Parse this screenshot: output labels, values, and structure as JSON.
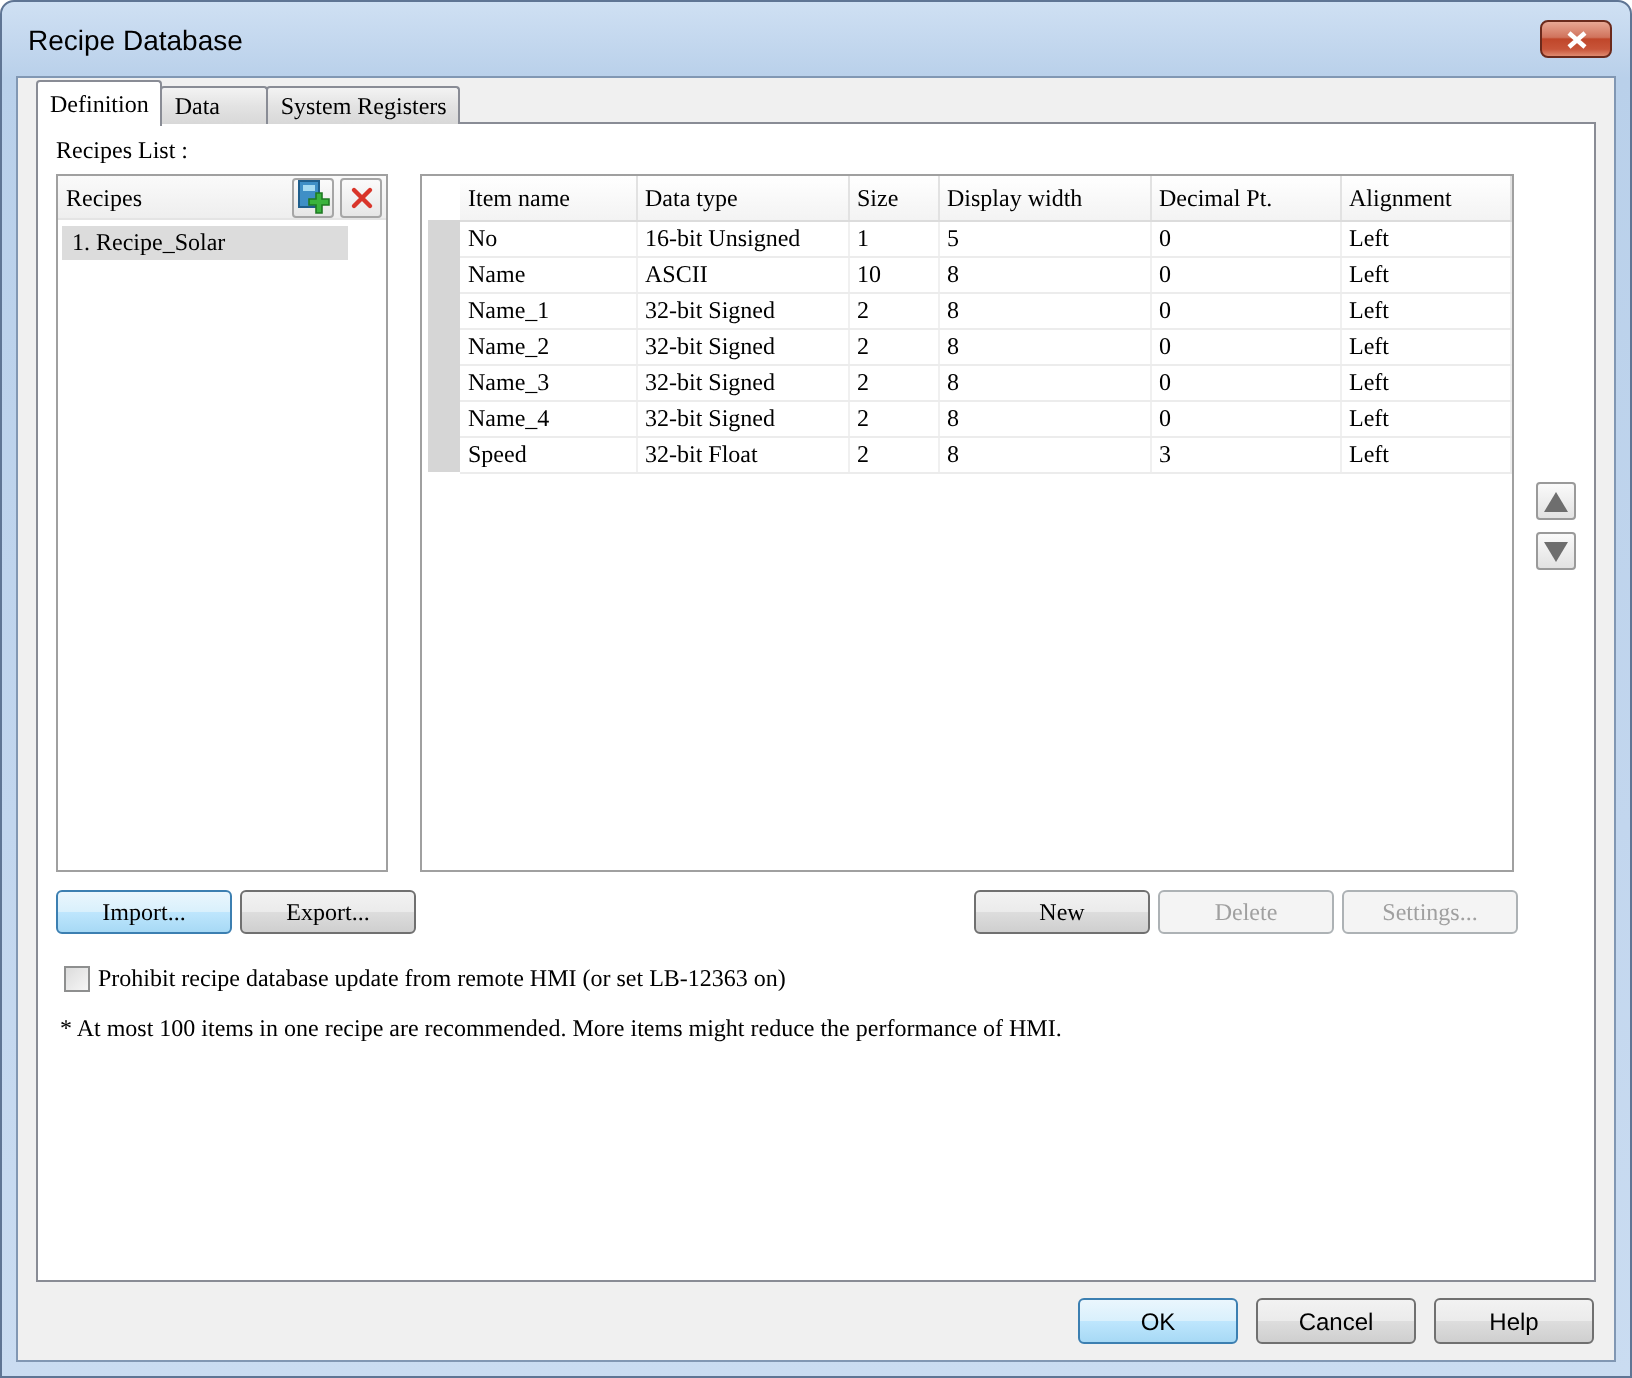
{
  "window": {
    "title": "Recipe Database"
  },
  "tabs": [
    {
      "label": "Definition",
      "selected": true
    },
    {
      "label": "Data",
      "selected": false
    },
    {
      "label": "System Registers",
      "selected": false
    }
  ],
  "recipes_list": {
    "label": "Recipes List :",
    "header": "Recipes",
    "items": [
      {
        "label": "1. Recipe_Solar",
        "selected": true
      }
    ]
  },
  "table": {
    "columns": [
      "Item name",
      "Data type",
      "Size",
      "Display width",
      "Decimal Pt.",
      "Alignment"
    ],
    "rows": [
      [
        "No",
        "16-bit Unsigned",
        "1",
        "5",
        "0",
        "Left"
      ],
      [
        "Name",
        "ASCII",
        "10",
        "8",
        "0",
        "Left"
      ],
      [
        "Name_1",
        "32-bit Signed",
        "2",
        "8",
        "0",
        "Left"
      ],
      [
        "Name_2",
        "32-bit Signed",
        "2",
        "8",
        "0",
        "Left"
      ],
      [
        "Name_3",
        "32-bit Signed",
        "2",
        "8",
        "0",
        "Left"
      ],
      [
        "Name_4",
        "32-bit Signed",
        "2",
        "8",
        "0",
        "Left"
      ],
      [
        "Speed",
        "32-bit Float",
        "2",
        "8",
        "3",
        "Left"
      ]
    ]
  },
  "recipe_buttons": [
    {
      "label": "Import...",
      "focused": true
    },
    {
      "label": "Export...",
      "focused": false
    }
  ],
  "item_buttons": [
    {
      "label": "New",
      "disabled": false
    },
    {
      "label": "Delete",
      "disabled": true
    },
    {
      "label": "Settings...",
      "disabled": true
    }
  ],
  "prohibit_remote_update": {
    "label": "Prohibit recipe database update from remote HMI (or set LB-12363 on)",
    "checked": false
  },
  "note": "* At most 100 items in one recipe are recommended. More items might reduce the performance of HMI.",
  "dialog_buttons": [
    {
      "label": "OK",
      "default": true
    },
    {
      "label": "Cancel",
      "default": false
    },
    {
      "label": "Help",
      "default": false
    }
  ]
}
